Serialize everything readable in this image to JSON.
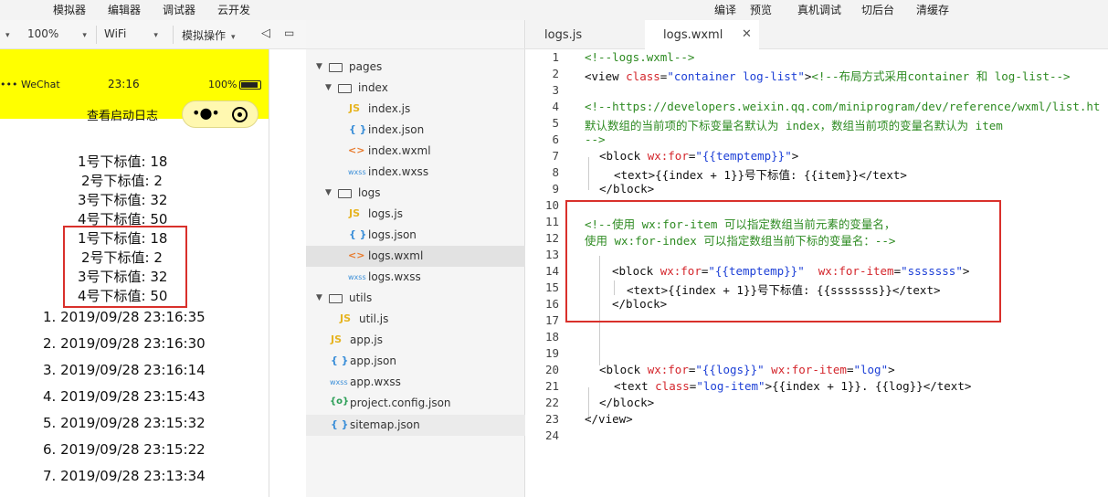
{
  "menubar": {
    "items": [
      "模拟器",
      "编辑器",
      "调试器",
      "云开发",
      "编译",
      "预览",
      "真机调试",
      "切后台",
      "清缓存"
    ]
  },
  "toolbar": {
    "zoom": "100%",
    "network": "WiFi",
    "sim_ops": "模拟操作"
  },
  "simulator": {
    "status": {
      "carrier": "••• WeChat",
      "time": "23:16",
      "battery": "100%"
    },
    "nav_title": "查看启动日志",
    "lines": [
      "1号下标值: 18",
      "2号下标值: 2",
      "3号下标值: 32",
      "4号下标值: 50",
      "1号下标值: 18",
      "2号下标值: 2",
      "3号下标值: 32",
      "4号下标值: 50"
    ],
    "logs": [
      "1. 2019/09/28 23:16:35",
      "2. 2019/09/28 23:16:30",
      "3. 2019/09/28 23:16:14",
      "4. 2019/09/28 23:15:43",
      "5. 2019/09/28 23:15:32",
      "6. 2019/09/28 23:15:22",
      "7. 2019/09/28 23:13:34"
    ]
  },
  "explorer": {
    "tree": [
      {
        "label": "pages",
        "type": "folder"
      },
      {
        "label": "index",
        "type": "folder"
      },
      {
        "label": "index.js",
        "type": "js"
      },
      {
        "label": "index.json",
        "type": "json"
      },
      {
        "label": "index.wxml",
        "type": "wxml"
      },
      {
        "label": "index.wxss",
        "type": "wxss"
      },
      {
        "label": "logs",
        "type": "folder"
      },
      {
        "label": "logs.js",
        "type": "js"
      },
      {
        "label": "logs.json",
        "type": "json"
      },
      {
        "label": "logs.wxml",
        "type": "wxml"
      },
      {
        "label": "logs.wxss",
        "type": "wxss"
      },
      {
        "label": "utils",
        "type": "folder"
      },
      {
        "label": "util.js",
        "type": "js"
      },
      {
        "label": "app.js",
        "type": "js"
      },
      {
        "label": "app.json",
        "type": "json"
      },
      {
        "label": "app.wxss",
        "type": "wxss"
      },
      {
        "label": "project.config.json",
        "type": "config"
      },
      {
        "label": "sitemap.json",
        "type": "json"
      }
    ],
    "selected": "logs.wxml"
  },
  "editor": {
    "tabs": [
      {
        "label": "logs.js"
      },
      {
        "label": "logs.wxml"
      }
    ],
    "active_tab": "logs.wxml",
    "line_numbers": [
      "1",
      "2",
      "3",
      "4",
      "5",
      "6",
      "7",
      "8",
      "9",
      "10",
      "11",
      "12",
      "13",
      "14",
      "15",
      "16",
      "17",
      "18",
      "19",
      "20",
      "21",
      "22",
      "23",
      "24"
    ],
    "code": {
      "l1": "<!--logs.wxml-->",
      "l2_a": "<view ",
      "l2_b": "class",
      "l2_c": "=",
      "l2_d": "\"container log-list\"",
      "l2_e": ">",
      "l2_f": "<!--布局方式采用container 和 log-list-->",
      "l4": "<!--https://developers.weixin.qq.com/miniprogram/dev/reference/wxml/list.ht",
      "l5": "默认数组的当前项的下标变量名默认为 index，数组当前项的变量名默认为 item",
      "l6": "-->",
      "l7_a": "<block ",
      "l7_b": "wx:for",
      "l7_c": "=",
      "l7_d": "\"{{temptemp}}\"",
      "l7_e": ">",
      "l8_a": "<text>",
      "l8_b": "{{index + 1}}号下标值: {{item}}",
      "l8_c": "</text>",
      "l9": "</block>",
      "l11": "<!--使用 wx:for-item 可以指定数组当前元素的变量名，",
      "l12": "使用 wx:for-index 可以指定数组当前下标的变量名：-->",
      "l14_a": "<block ",
      "l14_b": "wx:for",
      "l14_c": "=",
      "l14_d": "\"{{temptemp}}\"",
      "l14_e": "  wx:for-item",
      "l14_f": "=",
      "l14_g": "\"sssssss\"",
      "l14_h": ">",
      "l15_a": "<text>",
      "l15_b": "{{index + 1}}号下标值: {{sssssss}}",
      "l15_c": "</text>",
      "l16": "</block>",
      "l20_a": "<block ",
      "l20_b": "wx:for",
      "l20_c": "=",
      "l20_d": "\"{{logs}}\"",
      "l20_e": " wx:for-item",
      "l20_f": "=",
      "l20_g": "\"log\"",
      "l20_h": ">",
      "l21_a": "<text ",
      "l21_b": "class",
      "l21_c": "=",
      "l21_d": "\"log-item\"",
      "l21_e": ">",
      "l21_f": "{{index + 1}}. {{log}}",
      "l21_g": "</text>",
      "l22": "</block>",
      "l23": "</view>"
    }
  }
}
